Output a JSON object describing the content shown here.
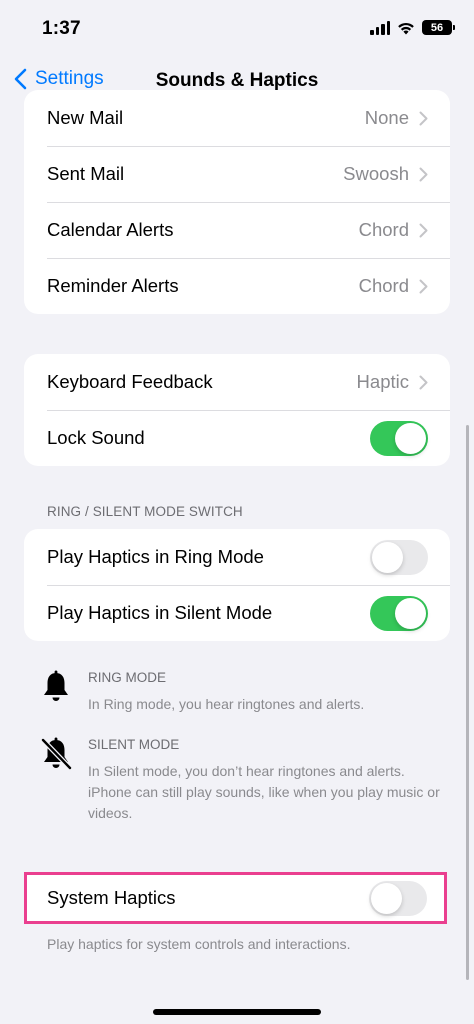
{
  "status": {
    "time": "1:37",
    "battery": "56",
    "icons": [
      "signal-icon",
      "wifi-icon",
      "battery-icon"
    ]
  },
  "nav": {
    "back_label": "Settings",
    "title": "Sounds & Haptics"
  },
  "alerts": [
    {
      "label": "New Mail",
      "value": "None"
    },
    {
      "label": "Sent Mail",
      "value": "Swoosh"
    },
    {
      "label": "Calendar Alerts",
      "value": "Chord"
    },
    {
      "label": "Reminder Alerts",
      "value": "Chord"
    }
  ],
  "feedback": {
    "keyboard_label": "Keyboard Feedback",
    "keyboard_value": "Haptic",
    "lock_label": "Lock Sound",
    "lock_on": true
  },
  "ring_switch": {
    "header": "RING / SILENT MODE SWITCH",
    "ring_label": "Play Haptics in Ring Mode",
    "ring_on": false,
    "silent_label": "Play Haptics in Silent Mode",
    "silent_on": true
  },
  "modes": {
    "ring_title": "RING MODE",
    "ring_desc": "In Ring mode, you hear ringtones and alerts.",
    "silent_title": "SILENT MODE",
    "silent_desc": "In Silent mode, you don’t hear ringtones and alerts. iPhone can still play sounds, like when you play music or videos."
  },
  "system": {
    "label": "System Haptics",
    "on": false,
    "footer": "Play haptics for system controls and interactions."
  },
  "colors": {
    "accent": "#007aff",
    "toggle_on": "#34c759",
    "highlight": "#ea3f8f"
  }
}
